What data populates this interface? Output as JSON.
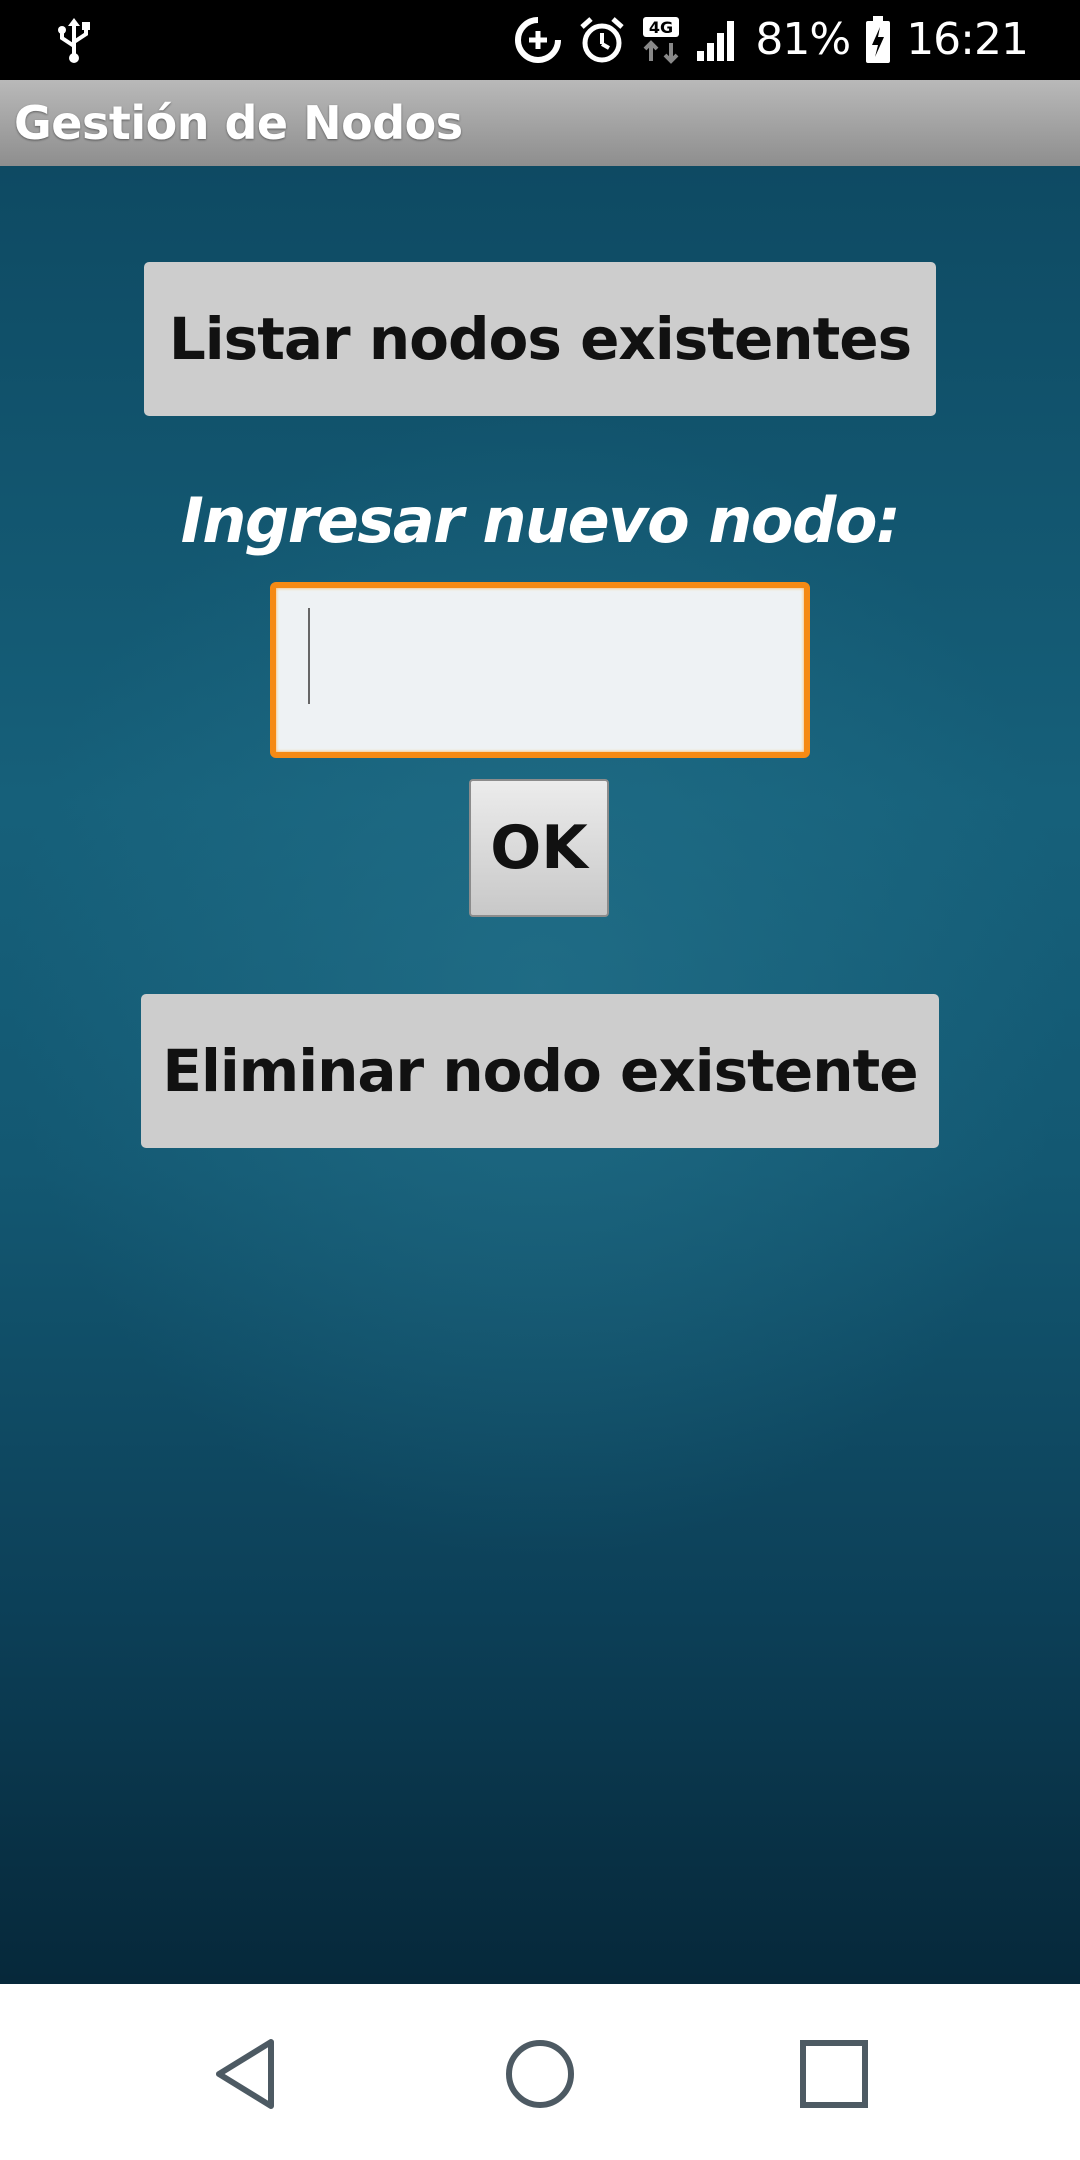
{
  "status_bar": {
    "icons": [
      "usb-icon",
      "data-saver-icon",
      "alarm-icon",
      "network-4g-icon",
      "signal-icon",
      "battery-charging-icon"
    ],
    "network_label": "4G",
    "battery_percent": "81%",
    "time": "16:21"
  },
  "action_bar": {
    "title": "Gestión de Nodos"
  },
  "main": {
    "list_button_label": "Listar nodos existentes",
    "new_node_label": "Ingresar nuevo nodo:",
    "new_node_input": {
      "value": "",
      "placeholder": ""
    },
    "ok_button_label": "OK",
    "delete_button_label": "Eliminar nodo existente"
  },
  "nav_bar": {
    "icons": [
      "back-icon",
      "home-icon",
      "recents-icon"
    ]
  },
  "colors": {
    "status_bar": "#000000",
    "action_bar": "#a3a3a3",
    "background": "#135872",
    "button": "#cdcdcd",
    "input_focus_border": "#f58a14"
  }
}
